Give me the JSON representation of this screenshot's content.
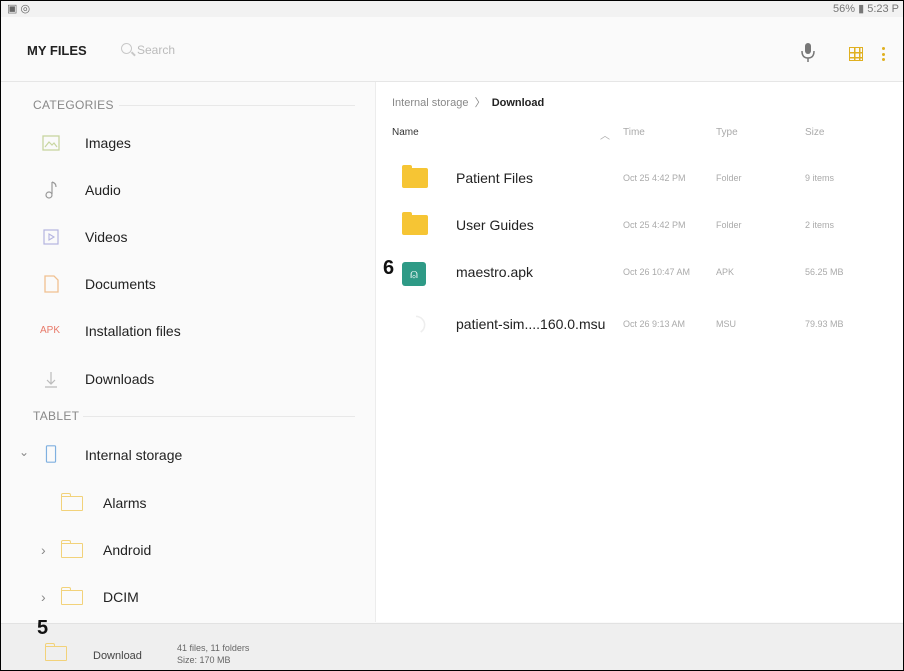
{
  "status": {
    "left_icons": "▣ ◎",
    "right_text": "56% ▮ 5:23 P"
  },
  "header": {
    "title": "MY FILES",
    "search_placeholder": "Search"
  },
  "sidebar": {
    "categories_heading": "CATEGORIES",
    "categories": [
      {
        "label": "Images",
        "icon": "image-icon"
      },
      {
        "label": "Audio",
        "icon": "music-note-icon"
      },
      {
        "label": "Videos",
        "icon": "video-icon"
      },
      {
        "label": "Documents",
        "icon": "document-icon"
      },
      {
        "label": "Installation files",
        "icon": "apk-text-icon",
        "icon_text": "APK"
      },
      {
        "label": "Downloads",
        "icon": "download-arrow-icon"
      }
    ],
    "tablet_heading": "TABLET",
    "tree": [
      {
        "label": "Internal storage",
        "expander": "⌄",
        "icon": "tablet-icon"
      },
      {
        "label": "Alarms",
        "icon": "folder-icon"
      },
      {
        "label": "Android",
        "expander": "›",
        "icon": "folder-icon"
      },
      {
        "label": "DCIM",
        "expander": "›",
        "icon": "folder-icon"
      }
    ]
  },
  "breadcrumb": {
    "parent": "Internal storage",
    "separator": "〉",
    "current": "Download"
  },
  "columns": {
    "name": "Name",
    "sort_arrow": "︿",
    "time": "Time",
    "type": "Type",
    "size": "Size"
  },
  "files": [
    {
      "name": "Patient Files",
      "time": "Oct 25 4:42 PM",
      "type": "Folder",
      "size": "9 items"
    },
    {
      "name": "User Guides",
      "time": "Oct 25 4:42 PM",
      "type": "Folder",
      "size": "2 items"
    },
    {
      "name": "maestro.apk",
      "time": "Oct 26 10:47 AM",
      "type": "APK",
      "size": "56.25 MB"
    },
    {
      "name": "patient-sim....160.0.msu",
      "time": "Oct 26 9:13 AM",
      "type": "MSU",
      "size": "79.93 MB"
    }
  ],
  "annotations": {
    "a6": "6",
    "a5": "5"
  },
  "bottom": {
    "label": "Download",
    "meta_line1": "41 files, 11 folders",
    "meta_line2": "Size: 170 MB"
  },
  "colors": {
    "accent": "#e0b020",
    "folder": "#f6c534",
    "apk": "#2e9a86"
  }
}
